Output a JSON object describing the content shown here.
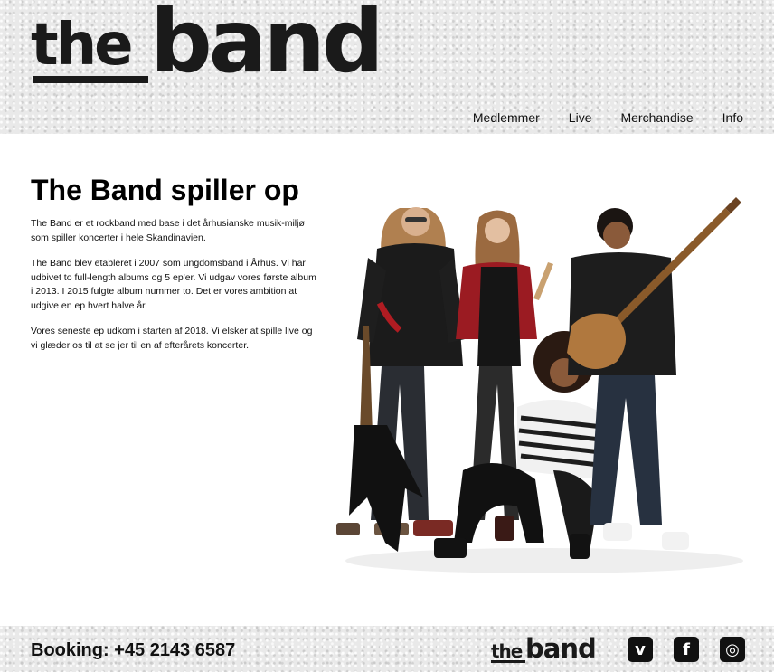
{
  "header": {
    "logo_the": "the",
    "logo_band": "band",
    "nav": [
      "Medlemmer",
      "Live",
      "Merchandise",
      "Info"
    ]
  },
  "main": {
    "title": "The Band spiller op",
    "paragraphs": [
      "The Band er et rockband med base i det århusianske musik-miljø som spiller koncerter i hele Skandinavien.",
      "The Band blev etableret i 2007 som ungdomsband i Århus. Vi har udbivet to full-length albums og 5 ep'er. Vi udgav vores første album i 2013. I 2015 fulgte album nummer to. Det er vores ambition at udgive en ep hvert halve år.",
      "Vores seneste ep udkom i starten af 2018. Vi elsker at spille live og vi glæder os til at se jer til en af efterårets koncerter."
    ]
  },
  "footer": {
    "booking": "Booking: +45 2143 6587",
    "logo_the": "the",
    "logo_band": "band",
    "social": [
      {
        "icon": "vimeo-icon",
        "glyph": "v"
      },
      {
        "icon": "facebook-icon",
        "glyph": "f"
      },
      {
        "icon": "instagram-icon",
        "glyph": "◎"
      }
    ]
  },
  "colors": {
    "text": "#111111",
    "texture_bg": "#e9e9e9",
    "accent_red": "#b01c22"
  }
}
